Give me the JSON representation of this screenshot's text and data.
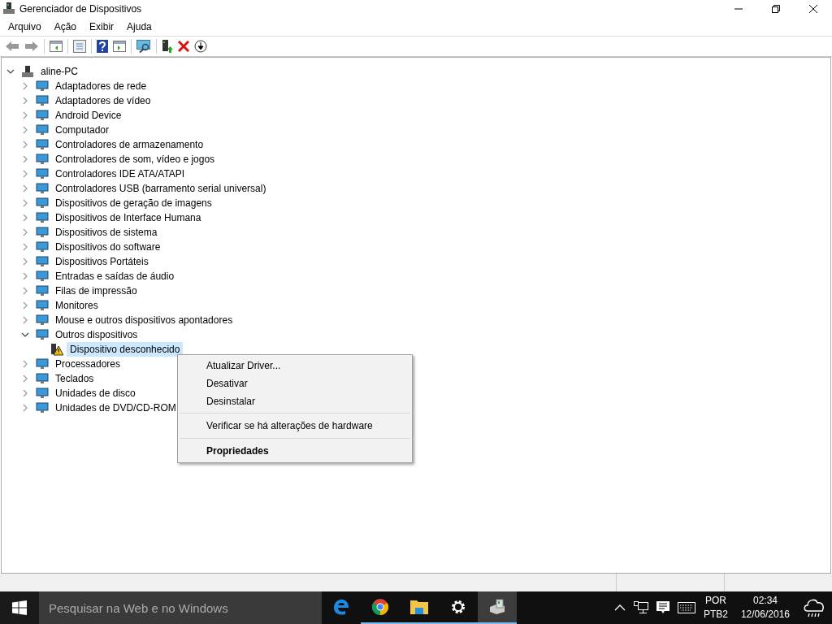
{
  "window": {
    "title": "Gerenciador de Dispositivos"
  },
  "menu": [
    "Arquivo",
    "Ação",
    "Exibir",
    "Ajuda"
  ],
  "tree": {
    "label": "aline-PC",
    "expanded": true,
    "children": [
      {
        "label": "Adaptadores de rede",
        "expanded": false
      },
      {
        "label": "Adaptadores de vídeo",
        "expanded": false
      },
      {
        "label": "Android Device",
        "expanded": false
      },
      {
        "label": "Computador",
        "expanded": false
      },
      {
        "label": "Controladores de armazenamento",
        "expanded": false
      },
      {
        "label": "Controladores de som, vídeo e jogos",
        "expanded": false
      },
      {
        "label": "Controladores IDE ATA/ATAPI",
        "expanded": false
      },
      {
        "label": "Controladores USB (barramento serial universal)",
        "expanded": false
      },
      {
        "label": "Dispositivos de geração de imagens",
        "expanded": false
      },
      {
        "label": "Dispositivos de Interface Humana",
        "expanded": false
      },
      {
        "label": "Dispositivos de sistema",
        "expanded": false
      },
      {
        "label": "Dispositivos do software",
        "expanded": false
      },
      {
        "label": "Dispositivos Portáteis",
        "expanded": false
      },
      {
        "label": "Entradas e saídas de áudio",
        "expanded": false
      },
      {
        "label": "Filas de impressão",
        "expanded": false
      },
      {
        "label": "Monitores",
        "expanded": false
      },
      {
        "label": "Mouse e outros dispositivos apontadores",
        "expanded": false
      },
      {
        "label": "Outros dispositivos",
        "expanded": true,
        "children": [
          {
            "label": "Dispositivo desconhecido",
            "selected": true,
            "warning": true
          }
        ]
      },
      {
        "label": "Processadores",
        "expanded": false
      },
      {
        "label": "Teclados",
        "expanded": false
      },
      {
        "label": "Unidades de disco",
        "expanded": false
      },
      {
        "label": "Unidades de DVD/CD-ROM",
        "expanded": false
      }
    ]
  },
  "context_menu": [
    {
      "label": "Atualizar Driver...",
      "bold": false,
      "separator_before": false
    },
    {
      "label": "Desativar",
      "bold": false,
      "separator_before": false
    },
    {
      "label": "Desinstalar",
      "bold": false,
      "separator_before": false
    },
    {
      "label": "Verificar se há alterações de hardware",
      "bold": false,
      "separator_before": true
    },
    {
      "label": "Propriedades",
      "bold": true,
      "separator_before": true
    }
  ],
  "taskbar": {
    "search": {
      "placeholder": "Pesquisar na Web e no Windows"
    },
    "apps": [
      {
        "kind": "edge",
        "open": false,
        "selected": false
      },
      {
        "kind": "chrome",
        "open": true,
        "selected": false
      },
      {
        "kind": "explorer",
        "open": true,
        "selected": false
      },
      {
        "kind": "settings",
        "open": true,
        "selected": false
      },
      {
        "kind": "devmgr",
        "open": true,
        "selected": true
      }
    ],
    "language": [
      "POR",
      "PTB2"
    ],
    "time": "02:34",
    "date": "12/06/2016"
  }
}
